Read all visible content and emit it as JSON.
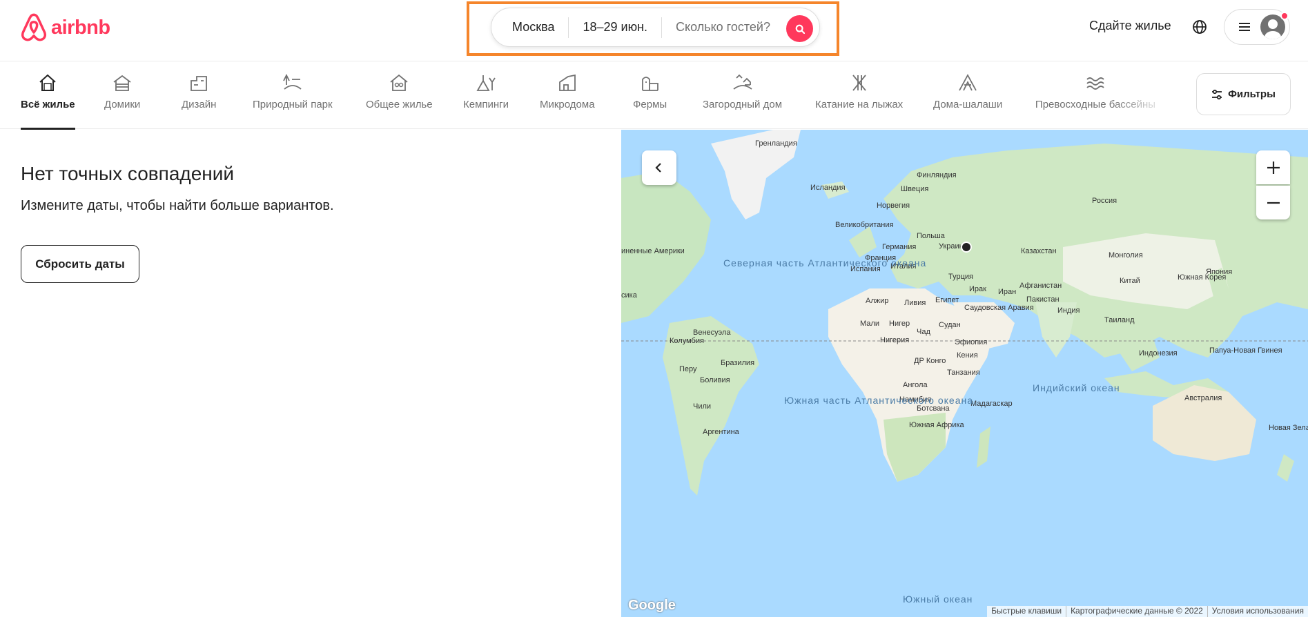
{
  "header": {
    "logo_text": "airbnb",
    "search": {
      "location": "Москва",
      "dates": "18–29 июн.",
      "guests_placeholder": "Сколько гостей?"
    },
    "host_link": "Сдайте жилье",
    "globe_icon": "globe-icon",
    "menu_icon": "hamburger-menu-icon",
    "accent_color": "#ff385c"
  },
  "categories": {
    "items": [
      {
        "label": "Всё жилье",
        "icon": "house-icon",
        "active": true
      },
      {
        "label": "Домики",
        "icon": "cabin-icon"
      },
      {
        "label": "Дизайн",
        "icon": "design-icon"
      },
      {
        "label": "Природный парк",
        "icon": "national-park-icon"
      },
      {
        "label": "Общее жилье",
        "icon": "shared-homes-icon"
      },
      {
        "label": "Кемпинги",
        "icon": "camping-icon"
      },
      {
        "label": "Микродома",
        "icon": "tiny-home-icon"
      },
      {
        "label": "Фермы",
        "icon": "farm-icon"
      },
      {
        "label": "Загородный дом",
        "icon": "countryside-icon"
      },
      {
        "label": "Катание на лыжах",
        "icon": "skiing-icon"
      },
      {
        "label": "Дома-шалаши",
        "icon": "a-frame-icon"
      },
      {
        "label": "Превосходные бассейны",
        "icon": "pool-icon"
      }
    ],
    "filters_label": "Фильтры"
  },
  "results": {
    "title": "Нет точных совпадений",
    "subtitle": "Измените даты, чтобы найти больше вариантов.",
    "reset_label": "Сбросить даты"
  },
  "map": {
    "labels": {
      "greenland": "Гренландия",
      "iceland": "Исландия",
      "finland": "Финляндия",
      "sweden": "Швеция",
      "norway": "Норвегия",
      "russia": "Россия",
      "uk": "Великобритания",
      "poland": "Польша",
      "germany": "Германия",
      "ukraine": "Украина",
      "france": "Франция",
      "italy": "Италия",
      "spain": "Испания",
      "kazakhstan": "Казахстан",
      "mongolia": "Монголия",
      "turkey": "Турция",
      "china": "Китай",
      "skorea": "Южная Корея",
      "japan": "Япония",
      "afghanistan": "Афганистан",
      "iraq": "Ирак",
      "iran": "Иран",
      "pakistan": "Пакистан",
      "algeria": "Алжир",
      "libya": "Ливия",
      "egypt": "Египет",
      "saudi": "Саудовская Аравия",
      "india": "Индия",
      "thailand": "Таиланд",
      "mali": "Мали",
      "niger": "Нигер",
      "sudan": "Судан",
      "chad": "Чад",
      "nigeria": "Нигерия",
      "ethiopia": "Эфиопия",
      "drc": "ДР Конго",
      "kenya": "Кения",
      "tanzania": "Танзания",
      "angola": "Ангола",
      "namibia": "Намибия",
      "botswana": "Ботсвана",
      "madagascar": "Мадагаскар",
      "safrica": "Южная Африка",
      "venezuela": "Венесуэла",
      "colombia": "Колумбия",
      "brazil": "Бразилия",
      "peru": "Перу",
      "bolivia": "Боливия",
      "chile": "Чили",
      "argentina": "Аргентина",
      "indonesia": "Индонезия",
      "png": "Папуа-Новая Гвинея",
      "australia": "Австралия",
      "nz": "Новая Зеландия",
      "usa_partial": "иненные Америки",
      "mexico_partial": "сика",
      "north_atlantic": "Северная часть Атлантического океана",
      "south_atlantic": "Южная часть Атлантического океана",
      "indian_ocean": "Индийский океан",
      "southern_ocean": "Южный океан"
    },
    "google_logo": "Google",
    "attribution": [
      "Быстрые клавиши",
      "Картографические данные © 2022",
      "Условия использования"
    ],
    "zoom_in_icon": "plus-icon",
    "zoom_out_icon": "minus-icon",
    "collapse_icon": "chevron-left-icon"
  }
}
